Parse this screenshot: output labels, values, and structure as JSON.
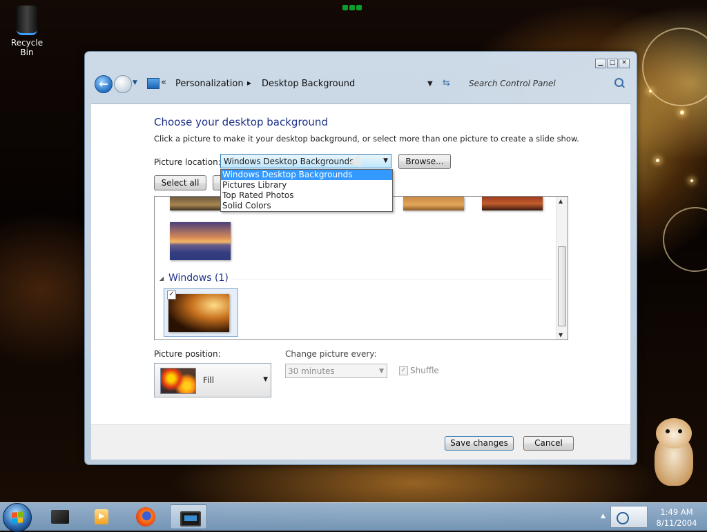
{
  "desktop": {
    "recycle_bin_label": "Recycle Bin"
  },
  "window": {
    "caption_buttons": {
      "minimize": "▁",
      "maximize": "□",
      "close": "✕"
    },
    "nav": {
      "back_glyph": "←",
      "breadcrumb_chevron": "«",
      "breadcrumb": [
        "Personalization",
        "Desktop Background"
      ],
      "breadcrumb_separator": "▸",
      "search_placeholder": "Search Control Panel"
    },
    "heading": "Choose your desktop background",
    "subtitle": "Click a picture to make it your desktop background, or select more than one picture to create a slide show.",
    "picture_location": {
      "label": "Picture location:",
      "value": "Windows Desktop Backgrounds",
      "options": [
        "Windows Desktop Backgrounds",
        "Pictures Library",
        "Top Rated Photos",
        "Solid Colors"
      ],
      "browse_label": "Browse..."
    },
    "select_all_label": "Select all",
    "clear_all_label": "",
    "gallery": {
      "group_title": "Windows (1)",
      "check_mark": "✓"
    },
    "picture_position": {
      "label": "Picture position:",
      "value": "Fill"
    },
    "change_picture": {
      "label": "Change picture every:",
      "value": "30 minutes"
    },
    "shuffle": {
      "label": "Shuffle",
      "checked_mark": "✓"
    },
    "footer": {
      "save_label": "Save changes",
      "cancel_label": "Cancel"
    }
  },
  "taskbar": {
    "clock_time": "1:49 AM",
    "clock_date": "8/11/2004"
  },
  "colors": {
    "heading_blue": "#1e3287",
    "selection_blue": "#3399ff",
    "taskbar": "#8fb0d0"
  }
}
